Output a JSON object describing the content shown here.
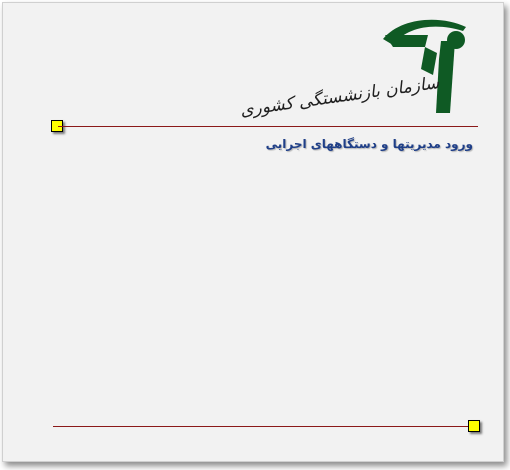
{
  "organization": {
    "name": "سازمان بازنشستگی کشوری",
    "logo_icon": "pension-organization-logo-icon",
    "logo_color": "#0f5a24"
  },
  "page": {
    "heading": "ورود مدیریتها و دستگاههای اجرایی"
  },
  "colors": {
    "background": "#f2f2f2",
    "rule": "#8b1a1a",
    "marker": "#ffff00",
    "heading": "#1f3f88"
  }
}
